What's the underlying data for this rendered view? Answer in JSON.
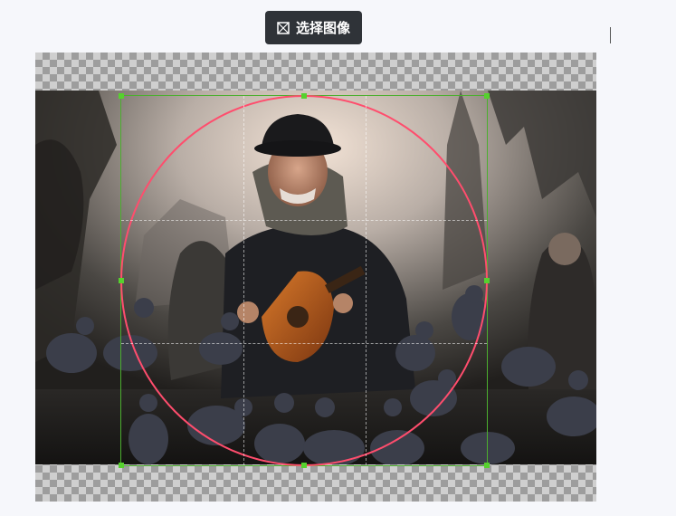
{
  "toolbar": {
    "select_image_label": "选择图像",
    "select_image_icon": "image-placeholder-icon"
  },
  "editor": {
    "photo": {
      "subject_icon": "musician-with-pigeons-photo"
    },
    "crop": {
      "shape": "circle",
      "frame_color": "#4caf2f",
      "circle_color": "#ff4d6d",
      "handle_color": "#56d12e"
    }
  }
}
